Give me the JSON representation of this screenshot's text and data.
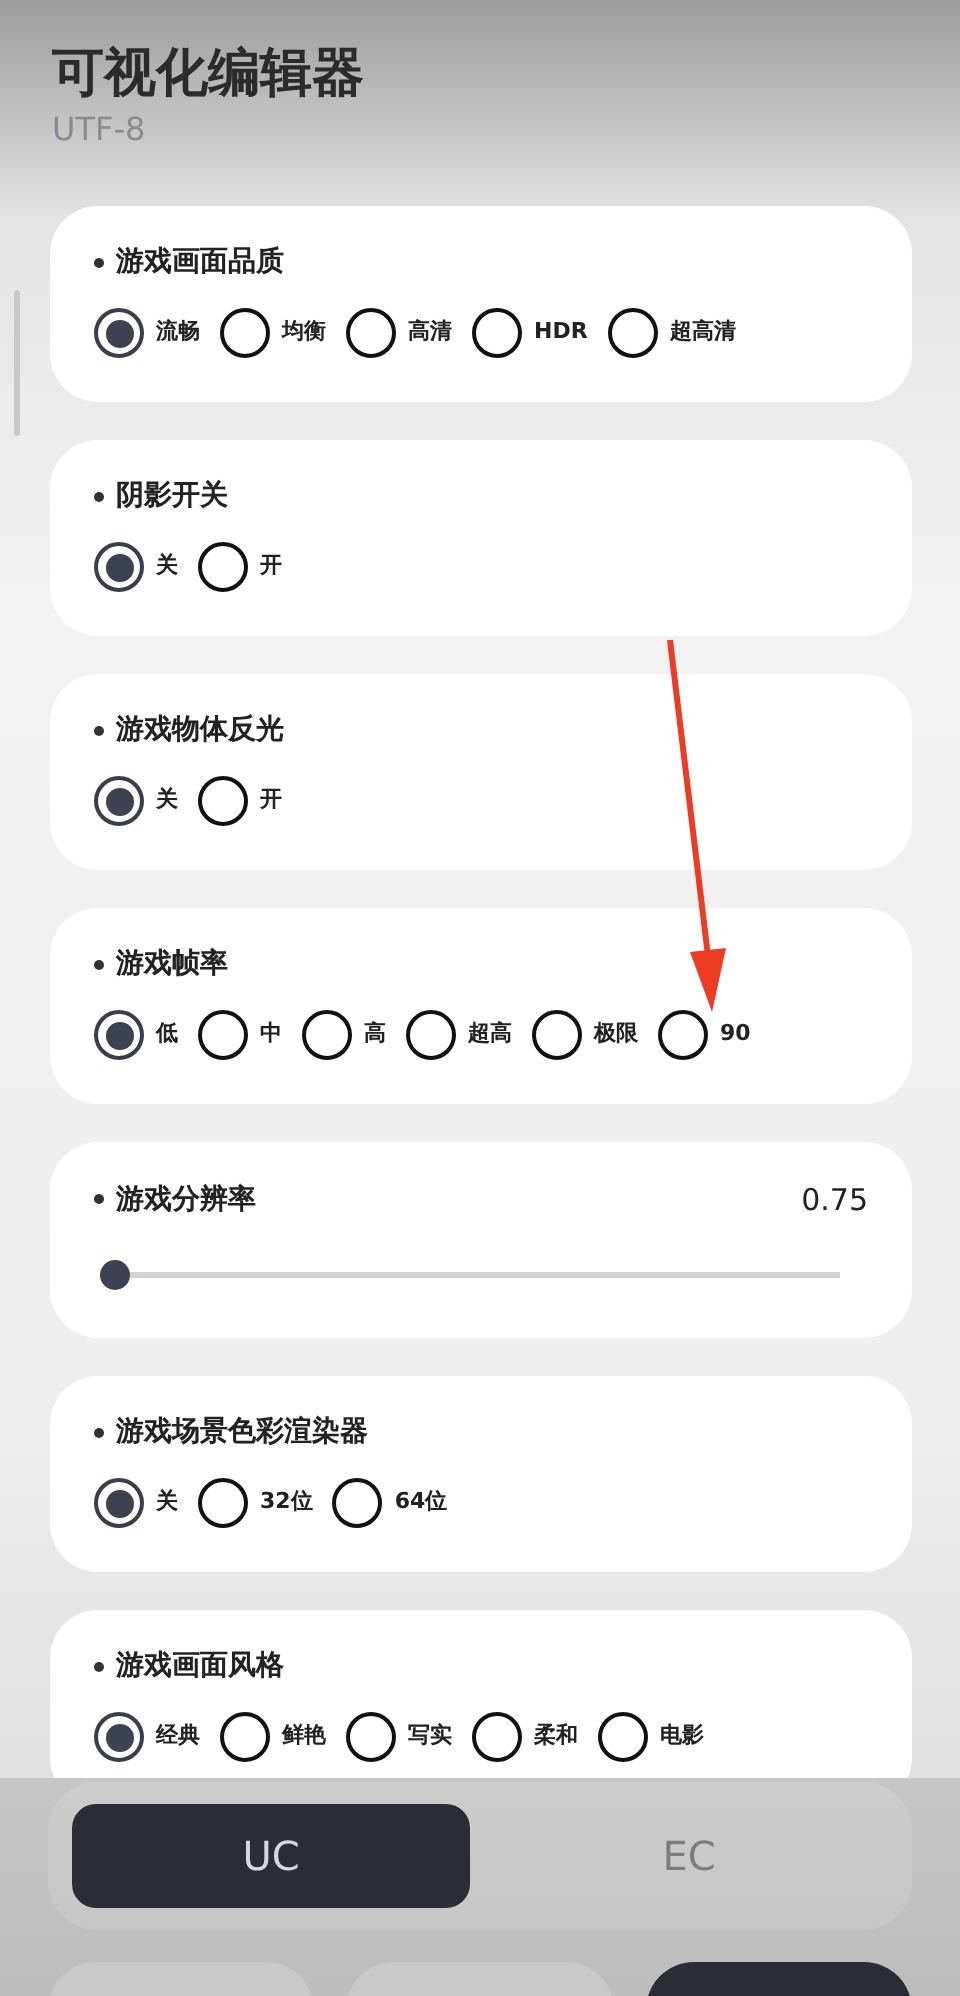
{
  "header": {
    "title": "可视化编辑器",
    "subtitle": "UTF-8"
  },
  "sections": [
    {
      "kind": "radio",
      "label": "游戏画面品质",
      "options": [
        {
          "label": "流畅",
          "selected": true
        },
        {
          "label": "均衡",
          "selected": false
        },
        {
          "label": "高清",
          "selected": false
        },
        {
          "label": "HDR",
          "selected": false
        },
        {
          "label": "超高清",
          "selected": false
        }
      ]
    },
    {
      "kind": "radio",
      "label": "阴影开关",
      "options": [
        {
          "label": "关",
          "selected": true
        },
        {
          "label": "开",
          "selected": false
        }
      ]
    },
    {
      "kind": "radio",
      "label": "游戏物体反光",
      "options": [
        {
          "label": "关",
          "selected": true
        },
        {
          "label": "开",
          "selected": false
        }
      ]
    },
    {
      "kind": "radio",
      "label": "游戏帧率",
      "options": [
        {
          "label": "低",
          "selected": true
        },
        {
          "label": "中",
          "selected": false
        },
        {
          "label": "高",
          "selected": false
        },
        {
          "label": "超高",
          "selected": false
        },
        {
          "label": "极限",
          "selected": false
        },
        {
          "label": "90",
          "selected": false
        }
      ]
    },
    {
      "kind": "slider",
      "label": "游戏分辨率",
      "reading": "0.75",
      "level": 0
    },
    {
      "kind": "radio",
      "label": "游戏场景色彩渲染器",
      "options": [
        {
          "label": "关",
          "selected": true
        },
        {
          "label": "32位",
          "selected": false
        },
        {
          "label": "64位",
          "selected": false
        }
      ]
    },
    {
      "kind": "radio",
      "label": "游戏画面风格",
      "options": [
        {
          "label": "经典",
          "selected": true
        },
        {
          "label": "鲜艳",
          "selected": false
        },
        {
          "label": "写实",
          "selected": false
        },
        {
          "label": "柔和",
          "selected": false
        },
        {
          "label": "电影",
          "selected": false
        }
      ]
    }
  ],
  "segments": [
    {
      "label": "UC",
      "selected": true
    },
    {
      "label": "EC",
      "selected": false
    }
  ],
  "footer_buttons": [
    {
      "selected": false
    },
    {
      "selected": false
    },
    {
      "selected": true
    }
  ]
}
